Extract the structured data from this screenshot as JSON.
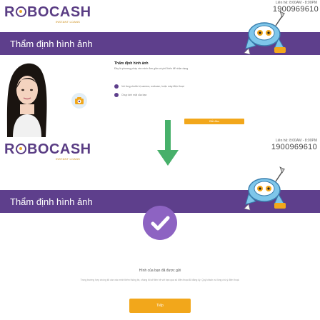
{
  "top": {
    "brand": {
      "pre": "R",
      "post": "BOCASH",
      "tagline": "INSTANT LOANS"
    },
    "hotline": {
      "label": "Liên hệ: 8:00AM - 8:00PM",
      "number": "1900969610"
    },
    "banner_title": "Thẩm định hình ảnh",
    "section_title": "Thẩm định hình ảnh",
    "section_desc": "Đây là phương pháp xác minh đơn giản và phổ biến để nhận dạng",
    "steps": [
      "Vui lòng chuẩn bị camera, webcam, hoặc máy điện thoại",
      "Chụp ảnh mặt của bạn"
    ],
    "button_label": "Bắt đầu"
  },
  "bottom": {
    "brand": {
      "pre": "R",
      "post": "BOCASH",
      "tagline": "INSTANT LOANS"
    },
    "hotline": {
      "label": "Liên hệ: 8:00AM - 8:00PM",
      "number": "1900969610"
    },
    "banner_title": "Thẩm định hình ảnh",
    "sent_message": "Hình của bạn đã được gửi",
    "fine_print": "Trong trường hợp chúng tôi cần xác minh thêm thông tin, chúng tôi sẽ liên hệ với bạn qua số điện thoại đã đăng ký. Quý khách vui lòng chú ý điện thoại.",
    "button_label": "Tiếp"
  },
  "colors": {
    "brand_purple": "#5e3f8c",
    "accent_orange": "#f2a71b",
    "arrow_green": "#47b06a",
    "check_purple": "#8d63c2"
  }
}
